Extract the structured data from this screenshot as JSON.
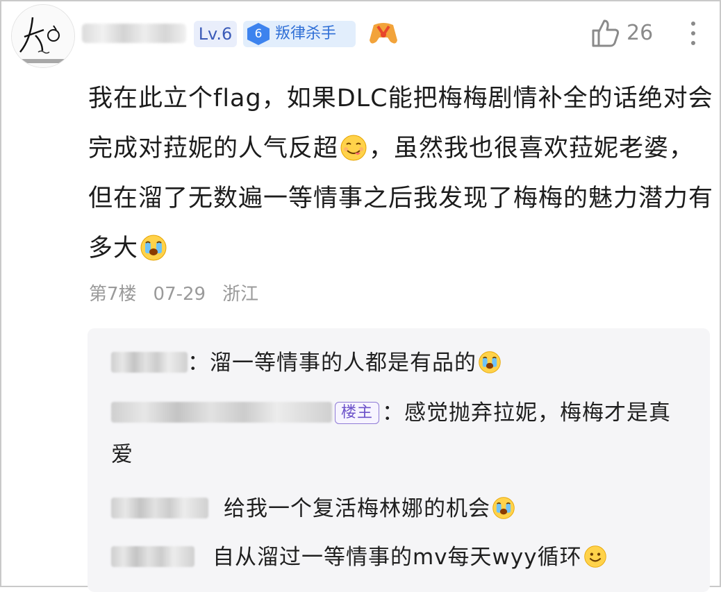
{
  "header": {
    "level_badge": "Lv.6",
    "title_badge": {
      "number": "6",
      "label": "叛律杀手"
    },
    "like_count": "26",
    "icons": [
      "avatar",
      "game-controller-icon",
      "thumbs-up-icon",
      "more-vertical-icon"
    ]
  },
  "comment": {
    "segments": [
      "我在此立个flag，如果DLC能把梅梅剧情补全的话绝对会完成对菈妮的人气反超",
      "，虽然我也很喜欢菈妮老婆，但在溜了无数遍一等情事之后我发现了梅梅的魅力潜力有多大"
    ],
    "floor": "第7楼",
    "date": "07-29",
    "location": "浙江"
  },
  "replies": [
    {
      "text": "：溜一等情事的人都是有品的",
      "emoji": "crying-emoji"
    },
    {
      "op_badge": "楼主",
      "text": "：感觉抛弃拉妮，梅梅才是真爱"
    },
    {
      "text": "给我一个复活梅林娜的机会",
      "emoji": "crying-emoji"
    },
    {
      "text": "自从溜过一等情事的mv每天wyy循环",
      "emoji": "smile-emoji"
    }
  ],
  "colors": {
    "level_bg": "#e9eefb",
    "title_badge_bg": "#e2eefc",
    "title_badge_accent": "#3d83ee",
    "reply_bg": "#f5f5f7",
    "meta_gray": "#9a9a9a",
    "op_badge": "#6c52c9"
  }
}
